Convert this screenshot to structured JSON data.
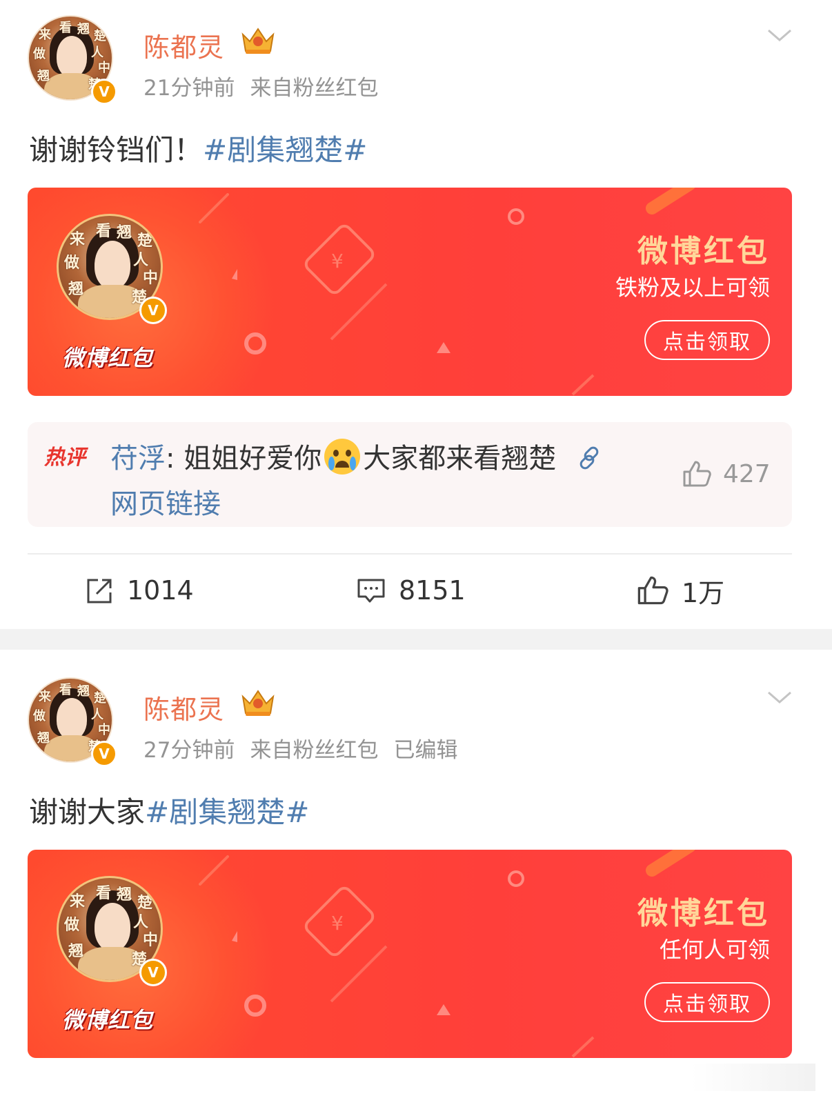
{
  "posts": [
    {
      "username": "陈都灵",
      "time": "21分钟前",
      "source": "来自粉丝红包",
      "edited": "",
      "text": "谢谢铃铛们！",
      "topic": "#剧集翘楚#",
      "avatar_text": [
        "来",
        "看",
        "翘",
        "楚",
        "做",
        "人",
        "中",
        "翘",
        "楚"
      ],
      "verified_badge": "V",
      "red_packet": {
        "logo": "微博红包",
        "title": "微博红包",
        "condition": "铁粉及以上可领",
        "button": "点击领取"
      },
      "hot_comment": {
        "badge": "热评",
        "author": "苻浮",
        "separator": ":",
        "text_before_emoji": " 姐姐好爱你",
        "emoji": "crying-face-emoji",
        "text_after_emoji": "大家都来看翘楚",
        "link_label": "网页链接",
        "likes": "427"
      },
      "actions": {
        "reposts": "1014",
        "comments": "8151",
        "likes": "1万"
      }
    },
    {
      "username": "陈都灵",
      "time": "27分钟前",
      "source": "来自粉丝红包",
      "edited": "已编辑",
      "text": "谢谢大家",
      "topic": "#剧集翘楚#",
      "verified_badge": "V",
      "red_packet": {
        "logo": "微博红包",
        "title": "微博红包",
        "condition": "任何人可领",
        "button": "点击领取"
      }
    }
  ],
  "colors": {
    "username": "#eb7350",
    "topic": "#507daf",
    "meta": "#939393",
    "card_red": "#ff4343",
    "card_title": "#ffd79a",
    "badge_orange": "#f59a00"
  },
  "icons": {
    "crown": "crown-icon",
    "chevron": "chevron-down-icon",
    "repost": "repost-icon",
    "comment": "comment-icon",
    "like": "thumbs-up-icon",
    "link": "link-icon"
  }
}
